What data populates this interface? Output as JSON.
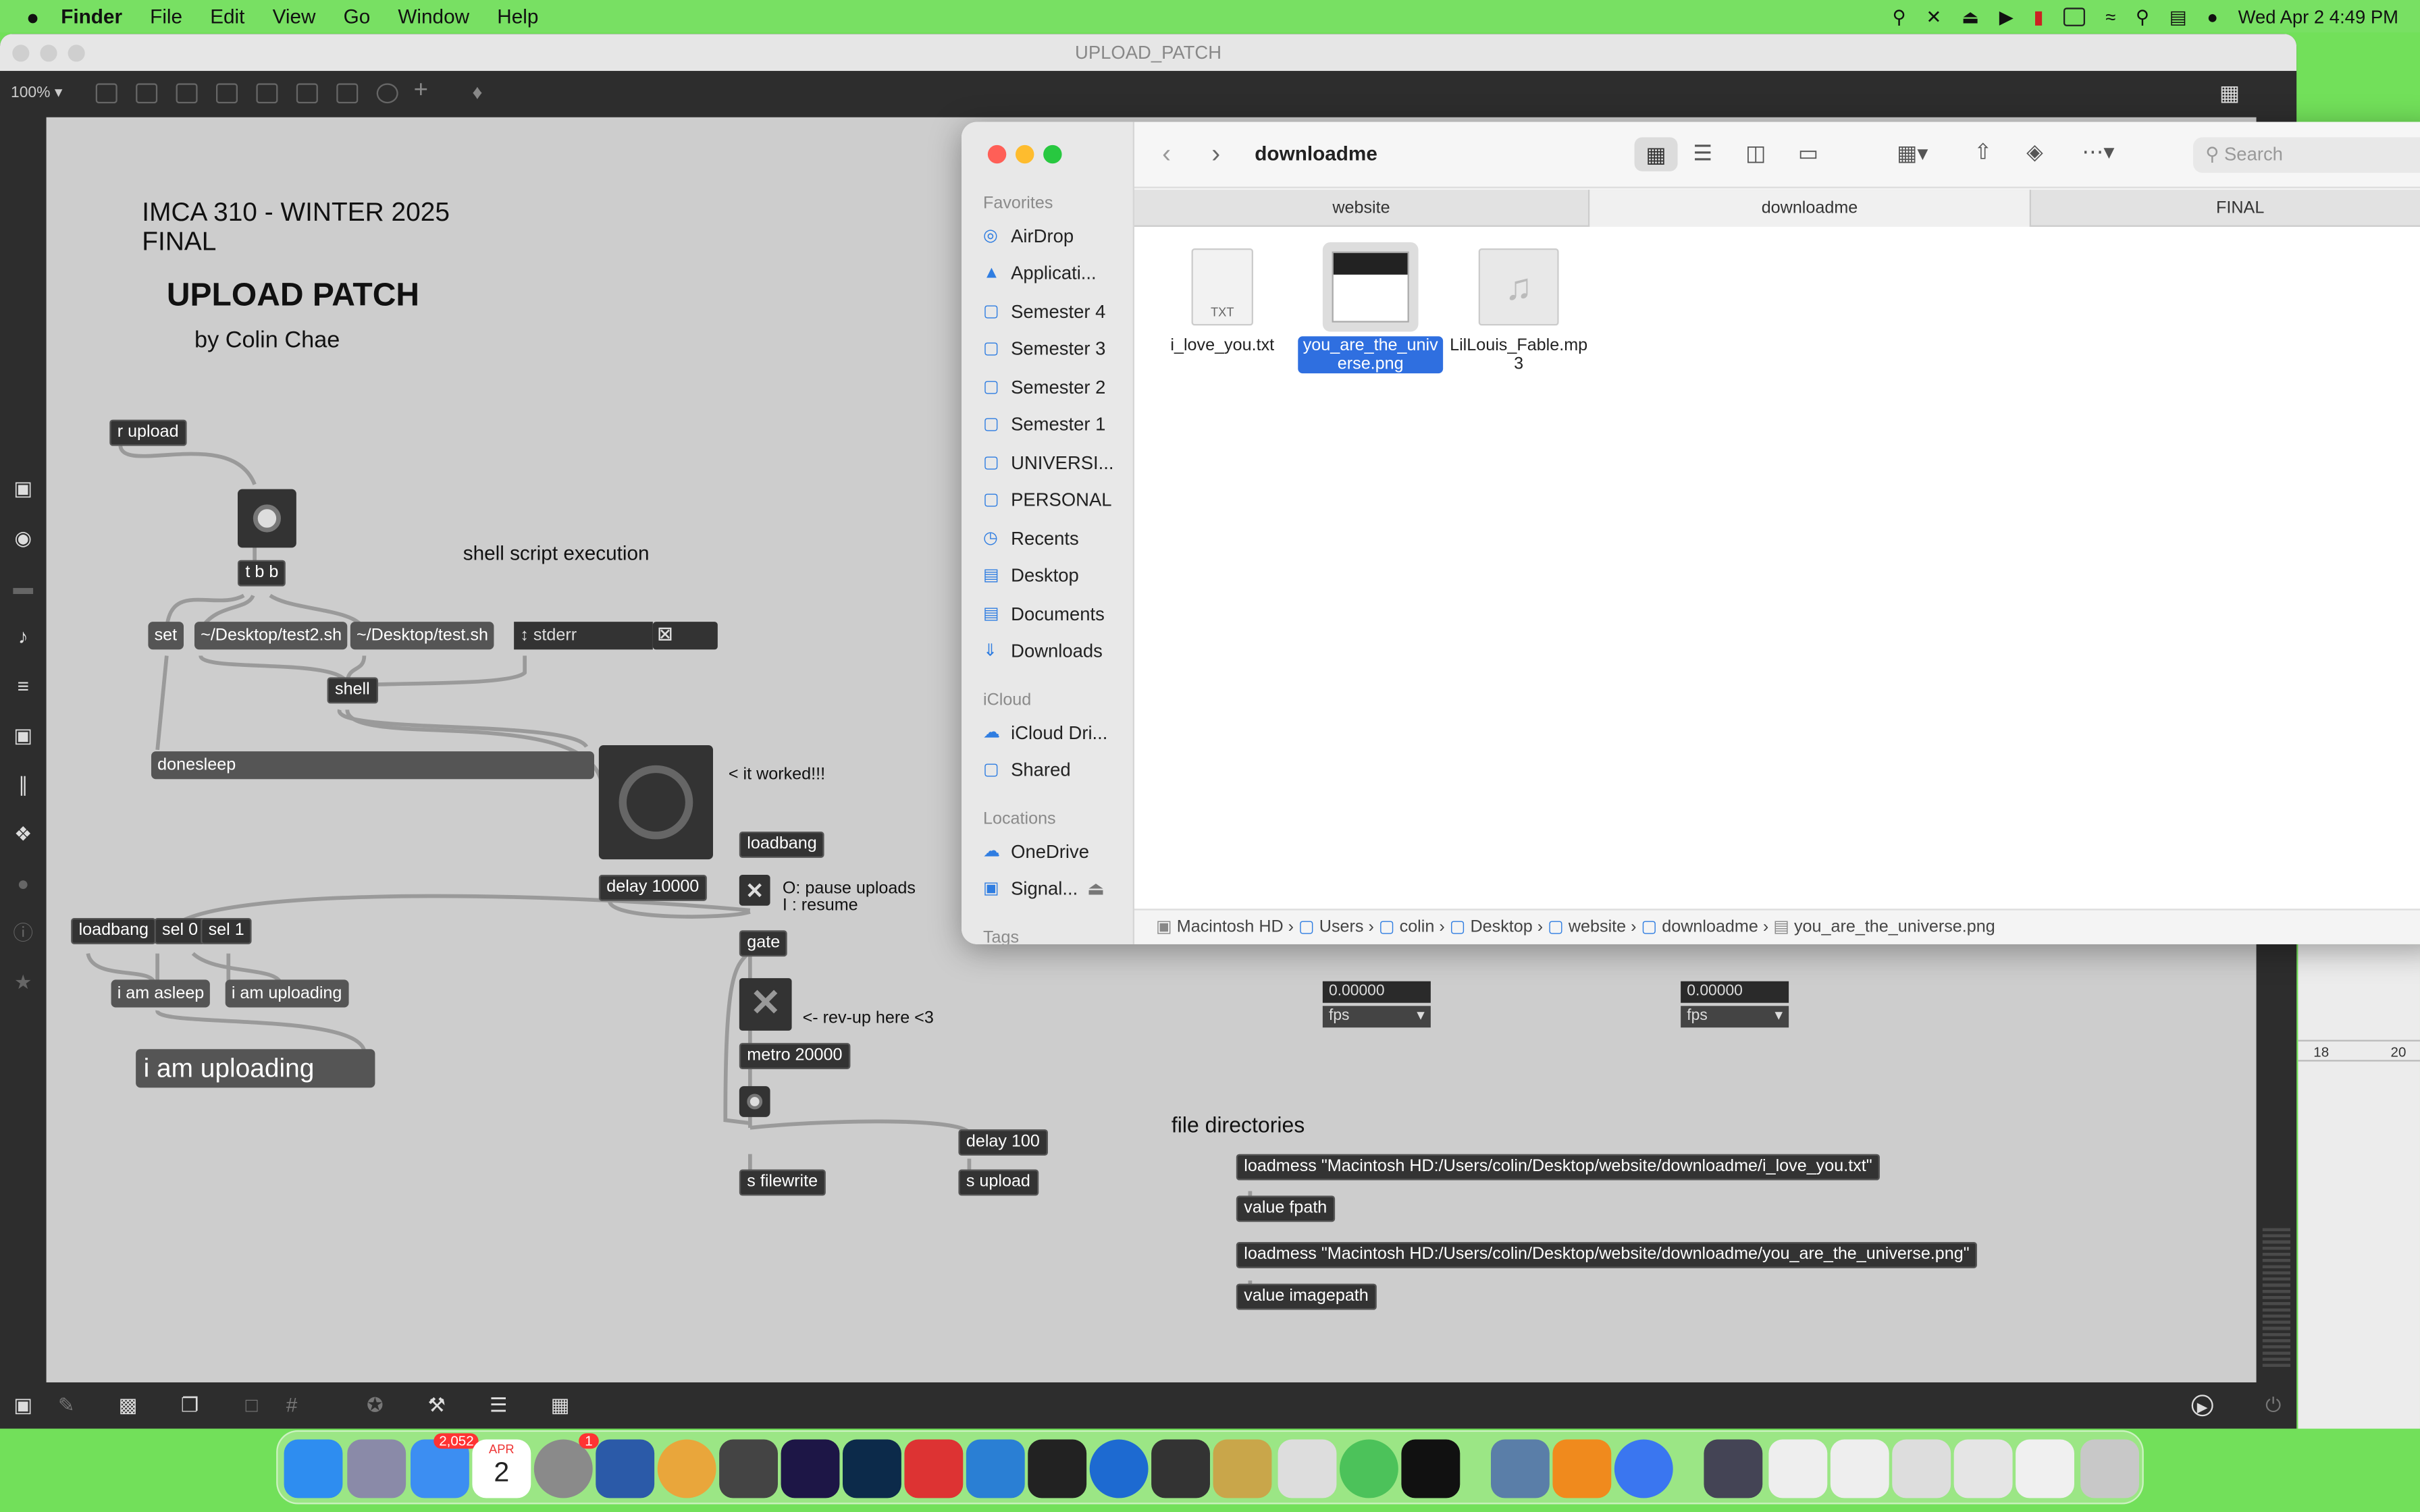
{
  "menubar": {
    "app": "Finder",
    "items": [
      "File",
      "Edit",
      "View",
      "Go",
      "Window",
      "Help"
    ],
    "datetime": "Wed Apr 2  4:49 PM"
  },
  "max": {
    "title": "UPLOAD_PATCH",
    "zoom": "100%"
  },
  "patch": {
    "title1": "IMCA 310 - WINTER 2025",
    "title2": "FINAL",
    "heading": "UPLOAD PATCH",
    "author": "by Colin Chae",
    "comment_shell": "shell script execution",
    "comment_worked": "< it worked!!!",
    "comment_pause1": "O: pause uploads",
    "comment_pause2": "I : resume",
    "comment_revup": "<- rev-up here <3",
    "comment_files": "file directories",
    "obj_r_upload": "r upload",
    "obj_tbb": "t b b",
    "obj_set": "set",
    "obj_test2": "~/Desktop/test2.sh",
    "obj_test": "~/Desktop/test.sh",
    "obj_stderr": "stderr",
    "obj_shell": "shell",
    "obj_donesleep": "donesleep",
    "obj_delay10000": "delay 10000",
    "obj_loadbang1": "loadbang",
    "obj_loadbang2": "loadbang",
    "obj_sel0": "sel 0",
    "obj_sel1": "sel 1",
    "obj_gate": "gate",
    "obj_asleep": "i am asleep",
    "obj_uploading": "i am uploading",
    "obj_big_uploading": "i am uploading",
    "obj_metro": "metro 20000",
    "obj_delay100": "delay 100",
    "obj_sfilewrite": "s filewrite",
    "obj_supload": "s upload",
    "loadmess1": "loadmess \"Macintosh HD:/Users/colin/Desktop/website/downloadme/i_love_you.txt\"",
    "value_fpath": "value fpath",
    "loadmess2": "loadmess \"Macintosh HD:/Users/colin/Desktop/website/downloadme/you_are_the_universe.png\"",
    "value_imagepath": "value imagepath",
    "num1": "0.00000",
    "fps1": "fps",
    "num2": "0.00000",
    "fps2": "fps"
  },
  "finder": {
    "title": "downloadme",
    "search_placeholder": "Search",
    "favorites_label": "Favorites",
    "icloud_label": "iCloud",
    "locations_label": "Locations",
    "tags_label": "Tags",
    "favorites": [
      "AirDrop",
      "Applicati...",
      "Semester 4",
      "Semester 3",
      "Semester 2",
      "Semester 1",
      "UNIVERSI...",
      "PERSONAL",
      "Recents",
      "Desktop",
      "Documents",
      "Downloads"
    ],
    "icloud": [
      "iCloud Dri...",
      "Shared"
    ],
    "locations": [
      "OneDrive",
      "Signal..."
    ],
    "tabs": [
      "website",
      "downloadme",
      "FINAL"
    ],
    "files": [
      {
        "name": "i_love_you.txt",
        "badge": "TXT"
      },
      {
        "name": "you_are_the_universe.png",
        "display1": "you_are_the_univ",
        "display2": "erse.png"
      },
      {
        "name": "LilLouis_Fable.mp3",
        "display1": "LilLouis_Fable.mp",
        "display2": "3"
      }
    ],
    "path": [
      "Macintosh HD",
      "Users",
      "colin",
      "Desktop",
      "website",
      "downloadme",
      "you_are_the_universe.png"
    ]
  },
  "dock": {
    "mail_badge": "2,052",
    "calendar_month": "APR",
    "calendar_day": "2",
    "settings_badge": "1"
  },
  "rightwin": {
    "tick1": "18",
    "tick2": "20"
  },
  "colors": {
    "desktop": "#72e05a",
    "selection": "#2f6fe0"
  }
}
